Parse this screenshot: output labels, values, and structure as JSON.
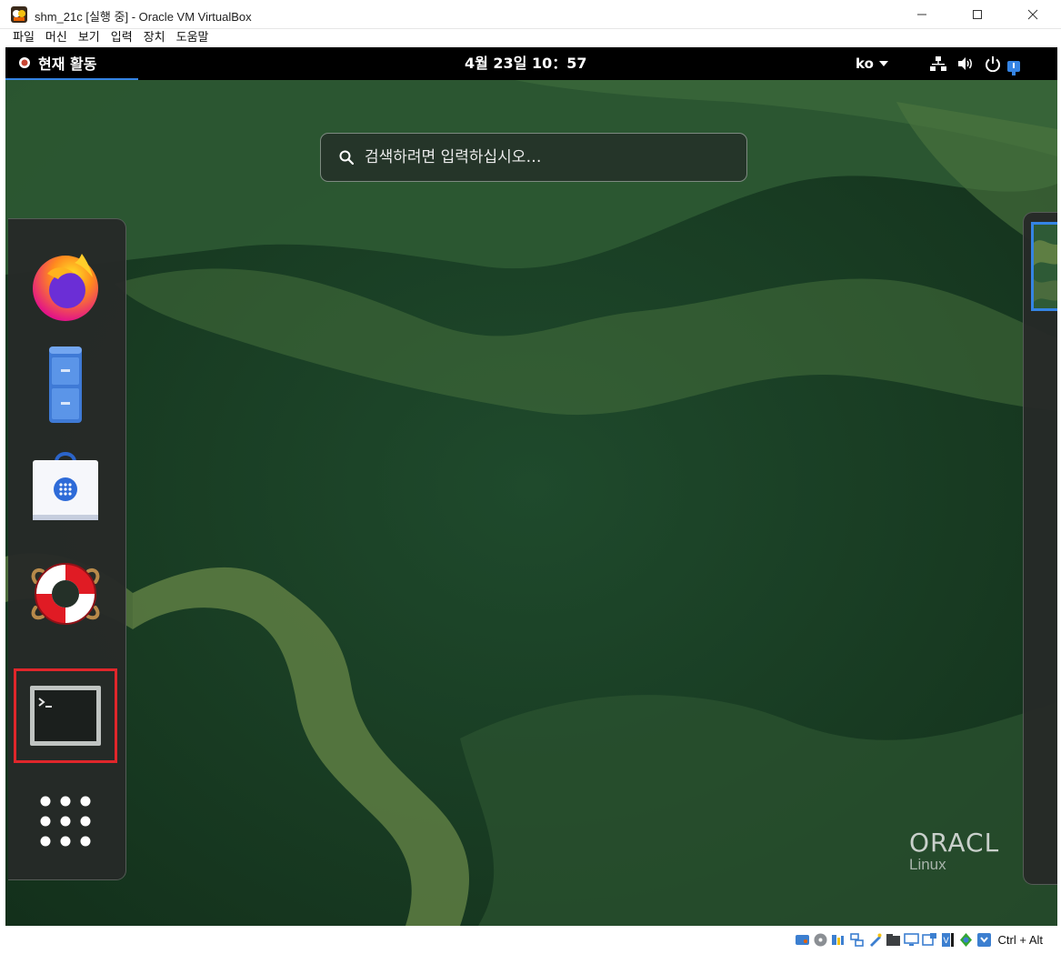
{
  "window": {
    "title": "shm_21c [실행 중] - Oracle VM VirtualBox",
    "controls": [
      "minimize-icon",
      "maximize-icon",
      "close-icon"
    ]
  },
  "menubar": {
    "items": [
      "파일",
      "머신",
      "보기",
      "입력",
      "장치",
      "도움말"
    ]
  },
  "guest": {
    "topbar": {
      "activities_label": "현재 활동",
      "clock": "4월 23일 10：57",
      "language": "ko",
      "tray_icons": [
        "network-icon",
        "volume-icon",
        "power-icon",
        "notification-icon"
      ]
    },
    "search": {
      "placeholder": "검색하려면 입력하십시오…"
    },
    "dash": {
      "items": [
        {
          "name": "firefox-icon"
        },
        {
          "name": "files-icon"
        },
        {
          "name": "software-store-icon"
        },
        {
          "name": "help-icon"
        },
        {
          "name": "terminal-icon",
          "highlighted": true
        },
        {
          "name": "show-apps-icon"
        }
      ]
    },
    "watermark": {
      "brand": "ORACL",
      "sub": "Linux"
    }
  },
  "statusbar": {
    "host_key": "Ctrl + Alt",
    "icons": [
      "hdd-icon",
      "optical-drive-icon",
      "audio-icon",
      "network-adapter-icon",
      "usb-icon",
      "shared-folders-icon",
      "display-icon",
      "video-capture-icon",
      "cpu-icon",
      "mouse-integration-icon",
      "keyboard-icon"
    ]
  },
  "colors": {
    "accent": "#3584e4",
    "highlight_box": "#e0262b",
    "wallpaper_dark": "#1d3a25",
    "wallpaper_light": "#4a6b3d"
  }
}
